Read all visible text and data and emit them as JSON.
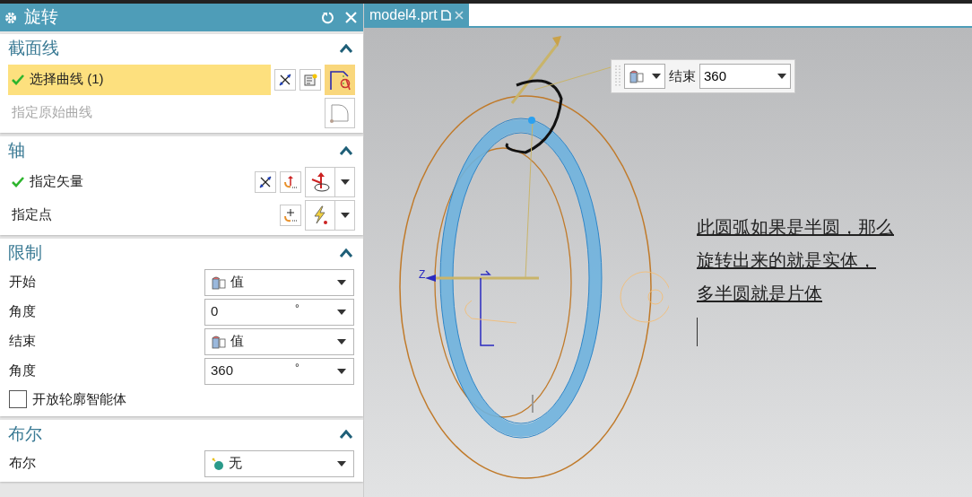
{
  "dialog": {
    "title": "旋转"
  },
  "sections": [
    {
      "title": "截面线",
      "expanded": true,
      "rows": [
        {
          "kind": "curve",
          "label": "选择曲线 (1)",
          "checked": true,
          "selected": true,
          "disabled": false
        },
        {
          "kind": "origin",
          "label": "指定原始曲线",
          "checked": false,
          "selected": false,
          "disabled": true
        }
      ]
    },
    {
      "title": "轴",
      "expanded": true,
      "rows": [
        {
          "kind": "vector",
          "label": "指定矢量",
          "checked": true,
          "selected": false,
          "disabled": false
        },
        {
          "kind": "point",
          "label": "指定点",
          "checked": false,
          "selected": false,
          "disabled": false
        }
      ]
    },
    {
      "title": "限制",
      "expanded": true,
      "rows": [
        {
          "kind": "method",
          "label": "开始",
          "value": "值"
        },
        {
          "kind": "angle",
          "label": "角度",
          "value": "0",
          "unit": "°"
        },
        {
          "kind": "method",
          "label": "结束",
          "value": "值"
        },
        {
          "kind": "angle",
          "label": "角度",
          "value": "360",
          "unit": "°"
        },
        {
          "kind": "checkbox",
          "label": "开放轮廓智能体",
          "checked": false
        }
      ]
    },
    {
      "title": "布尔",
      "expanded": true,
      "rows": [
        {
          "kind": "boolean",
          "label": "布尔",
          "value": "无"
        }
      ]
    }
  ],
  "tab": {
    "label": "model4.prt"
  },
  "axis_label": "Z",
  "float_toolbar": {
    "label": "结束",
    "value": "360"
  },
  "annotation": [
    "此圆弧如果是半圆，那么",
    "旋转出来的就是实体，",
    "多半圆就是片体"
  ]
}
